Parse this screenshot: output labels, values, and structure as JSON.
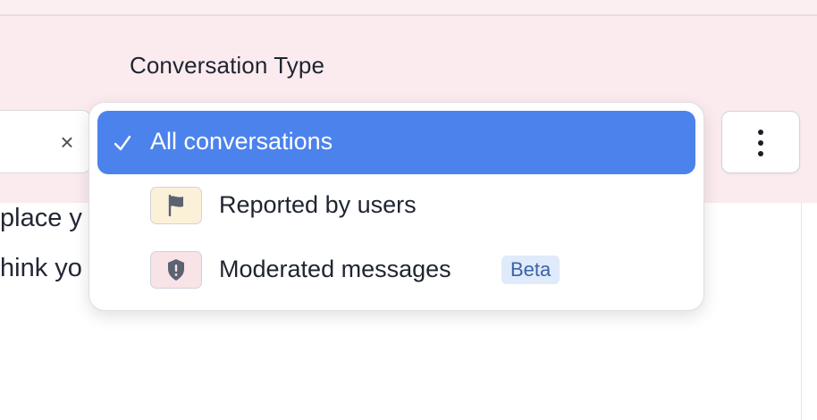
{
  "filter": {
    "label": "Conversation Type",
    "clear_icon": "close-icon",
    "clear_glyph": "×"
  },
  "background_text": {
    "line1": "place y",
    "line2": "hink yo"
  },
  "more_button": {
    "icon": "vertical-dots-icon"
  },
  "dropdown": {
    "options": [
      {
        "label": "All conversations",
        "selected": true,
        "icon": "check-icon"
      },
      {
        "label": "Reported by users",
        "selected": false,
        "icon": "flag-icon"
      },
      {
        "label": "Moderated messages",
        "selected": false,
        "icon": "shield-exclamation-icon",
        "badge": "Beta"
      }
    ]
  },
  "colors": {
    "selected_bg": "#4c82eb",
    "page_band": "#fbebee",
    "flag_tile_bg": "#fbf1d8",
    "shield_tile_bg": "#f8e3e6",
    "beta_badge_bg": "#dfeafb",
    "beta_badge_text": "#3a62a8"
  }
}
